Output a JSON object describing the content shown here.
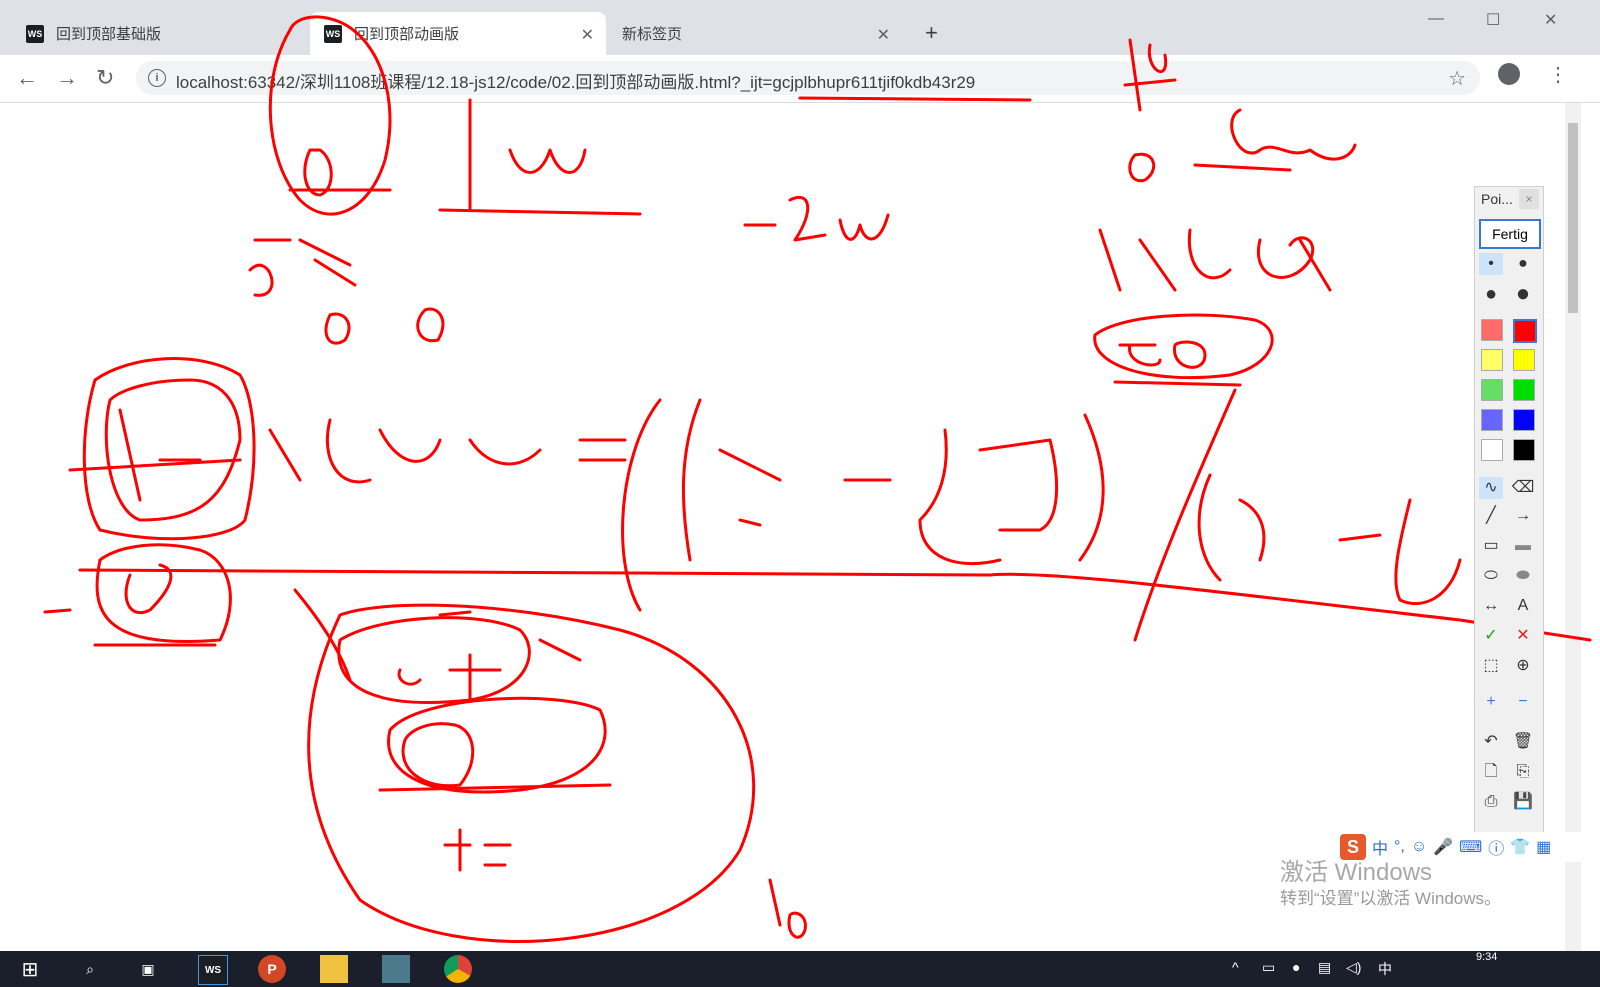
{
  "browser": {
    "tabs": [
      {
        "label": "回到顶部基础版",
        "icon": "WS"
      },
      {
        "label": "回到顶部动画版",
        "icon": "WS"
      },
      {
        "label": "新标签页",
        "icon": ""
      }
    ],
    "new_tab": "+",
    "window": {
      "minimize": "—",
      "maximize": "☐",
      "close": "✕"
    },
    "nav": {
      "back": "←",
      "forward": "→",
      "reload": "↻"
    },
    "url": "localhost:63342/深圳1108班课程/12.18-js12/code/02.回到顶部动画版.html?_ijt=gcjplbhupr611tjif0kdb43r29",
    "star": "☆",
    "menu": "⋮"
  },
  "palette": {
    "title": "Poi...",
    "close": "×",
    "done_button": "Fertig",
    "colors": [
      "#ff6b6b",
      "#ff0000",
      "#ffff66",
      "#ffff00",
      "#66dd66",
      "#00dd00",
      "#6666ff",
      "#0000ff",
      "#ffffff",
      "#000000"
    ],
    "tool_icons": [
      "pen-icon",
      "eraser-icon",
      "line-icon",
      "arrow-icon",
      "rect-icon",
      "filled-rect-icon",
      "ellipse-icon",
      "filled-ellipse-icon",
      "double-arrow-icon",
      "text-icon",
      "check-icon",
      "cross-icon",
      "crop-icon",
      "zoom-icon",
      "plus-icon",
      "minus-icon",
      "undo-icon",
      "trash-icon",
      "new-page-icon",
      "copy-icon",
      "print-icon",
      "save-icon"
    ]
  },
  "watermark": {
    "line1": "激活 Windows",
    "line2": "转到“设置”以激活 Windows。"
  },
  "ime": {
    "logo": "S",
    "lang": "中",
    "punct": "°,"
  },
  "taskbar": {
    "tray_lang": "中",
    "clock": "9:34"
  }
}
